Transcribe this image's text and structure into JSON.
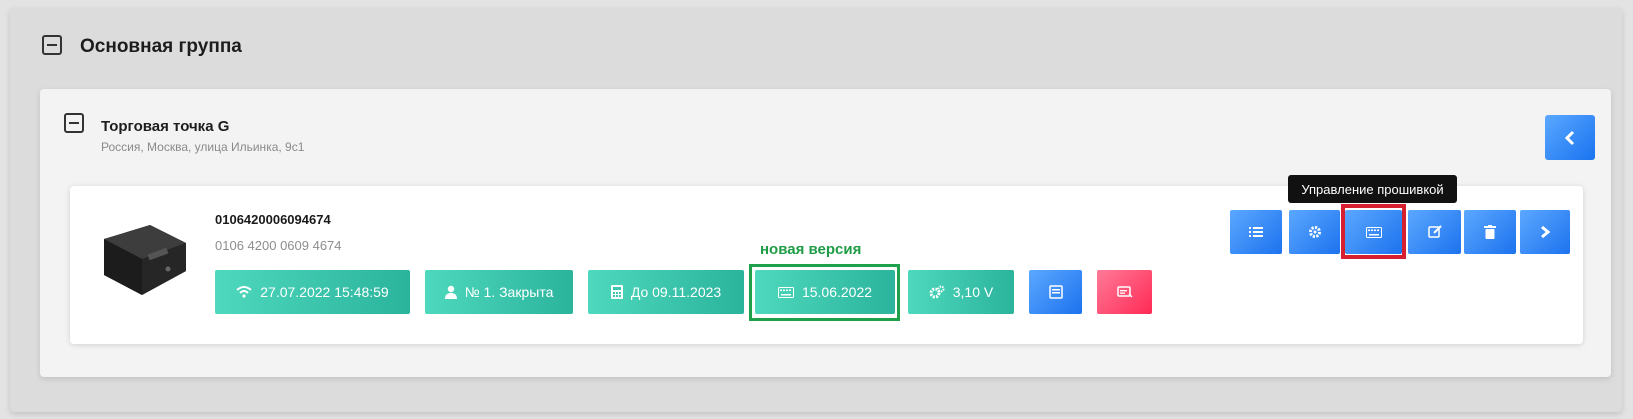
{
  "group": {
    "title": "Основная группа"
  },
  "store": {
    "name": "Торговая точка G",
    "address": "Россия, Москва, улица Ильинка, 9с1"
  },
  "device": {
    "id": "0106420006094674",
    "id_formatted": "0106 4200 0609 4674",
    "badges": {
      "connection": "27.07.2022 15:48:59",
      "shift": "№ 1. Закрыта",
      "fn_valid": "До 09.11.2023",
      "firmware": "15.06.2022",
      "voltage": "3,10 V"
    },
    "annotation": "новая версия",
    "tooltip": "Управление прошивкой"
  },
  "colors": {
    "teal": "#3cc8ae",
    "blue": "#2a7ff2",
    "red": "#ff3c63",
    "highlight_green": "#1fa04a",
    "highlight_red": "#d7202f"
  },
  "icons": {
    "connection": "wifi-icon",
    "shift": "user-icon",
    "fn_valid": "calculator-icon",
    "firmware": "keyboard-icon",
    "voltage": "cogs-icon",
    "list": "list-icon",
    "settings": "gear-icon",
    "firmware_action": "keyboard-icon",
    "edit": "edit-icon",
    "delete": "trash-icon",
    "next": "chevron-right-icon",
    "back": "chevron-left-icon"
  }
}
